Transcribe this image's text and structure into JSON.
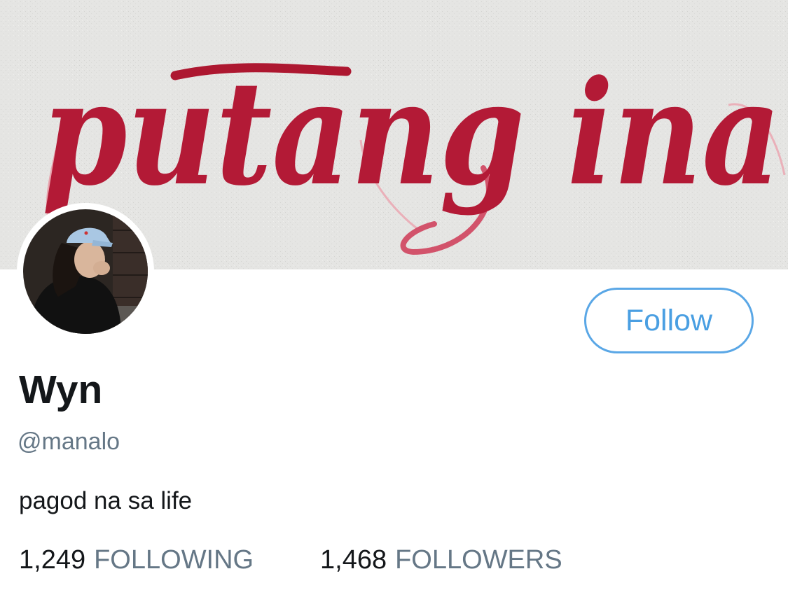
{
  "banner": {
    "lettering": "putang ina",
    "colors": {
      "paper": "#e4e4e2",
      "ink": "#b31a36",
      "ink_light": "#e07a8a"
    }
  },
  "profile": {
    "display_name": "Wyn",
    "handle": "@manalo",
    "bio": "pagod na sa life"
  },
  "actions": {
    "follow_label": "Follow",
    "accent": "#4a9fe2"
  },
  "stats": {
    "following": {
      "count": "1,249",
      "label": "FOLLOWING"
    },
    "followers": {
      "count": "1,468",
      "label": "FOLLOWERS"
    }
  }
}
